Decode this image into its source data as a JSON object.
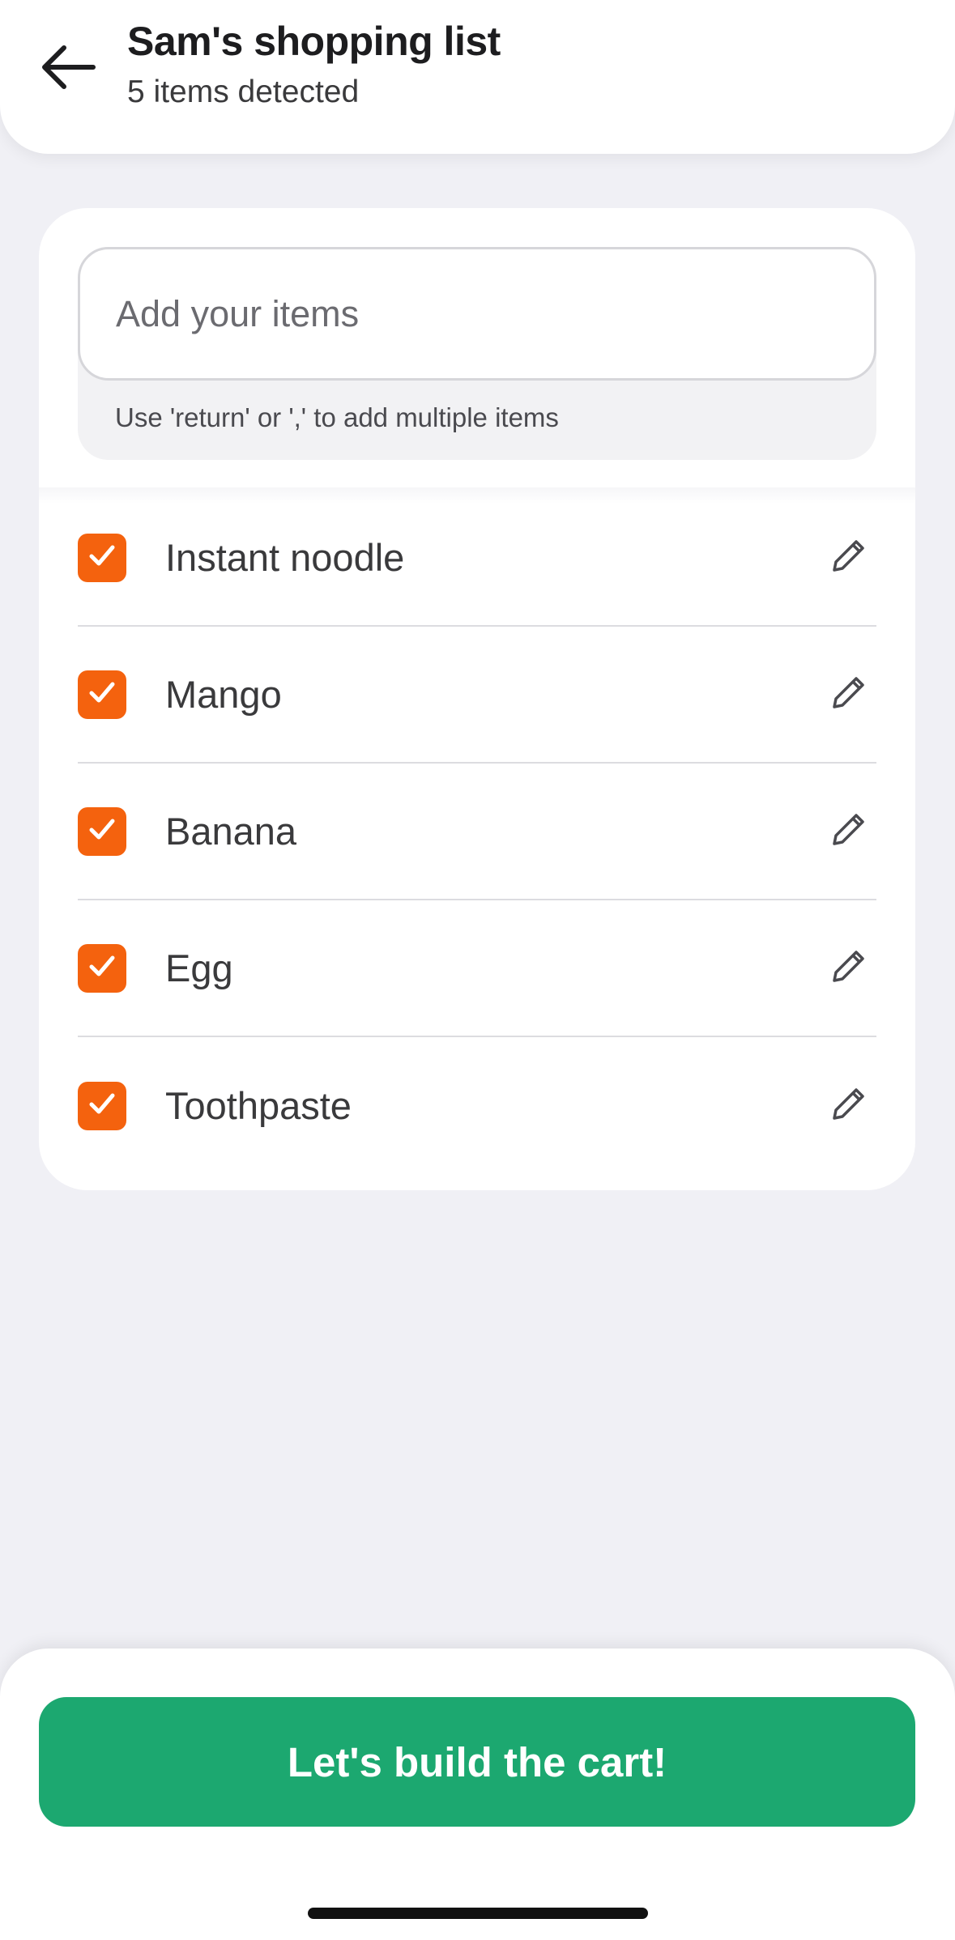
{
  "header": {
    "title": "Sam's shopping list",
    "subtitle": "5 items detected",
    "back_icon": "arrow-left-icon"
  },
  "input": {
    "placeholder": "Add your items",
    "value": "",
    "hint": "Use 'return' or ',' to add multiple items"
  },
  "items": [
    {
      "label": "Instant noodle",
      "checked": true
    },
    {
      "label": "Mango",
      "checked": true
    },
    {
      "label": "Banana",
      "checked": true
    },
    {
      "label": "Egg",
      "checked": true
    },
    {
      "label": "Toothpaste",
      "checked": true
    }
  ],
  "cta": {
    "label": "Let's build the cart!"
  },
  "colors": {
    "accent_orange": "#f4620e",
    "cta_green": "#1ca870",
    "background": "#f0f0f5"
  }
}
